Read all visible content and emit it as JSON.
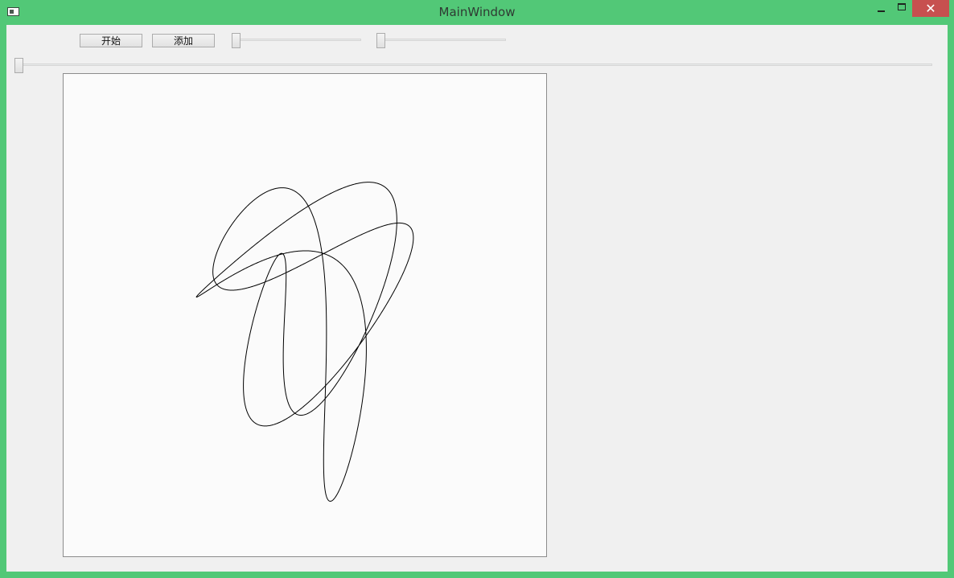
{
  "window": {
    "title": "MainWindow",
    "close_glyph": "✕",
    "icons": {
      "app": "app-window-icon",
      "minimize": "minimize-icon",
      "maximize": "maximize-icon",
      "close": "close-icon"
    }
  },
  "toolbar": {
    "start_label": "开始",
    "add_label": "添加",
    "slider_1_value": 0,
    "slider_2_value": 0
  },
  "timeline_slider_value": 0,
  "canvas": {
    "background": "#fbfbfb",
    "stroke_color": "#000000"
  },
  "colors": {
    "window_frame": "#52c877",
    "close_button": "#c7504f",
    "client_bg": "#f0f0f0"
  }
}
